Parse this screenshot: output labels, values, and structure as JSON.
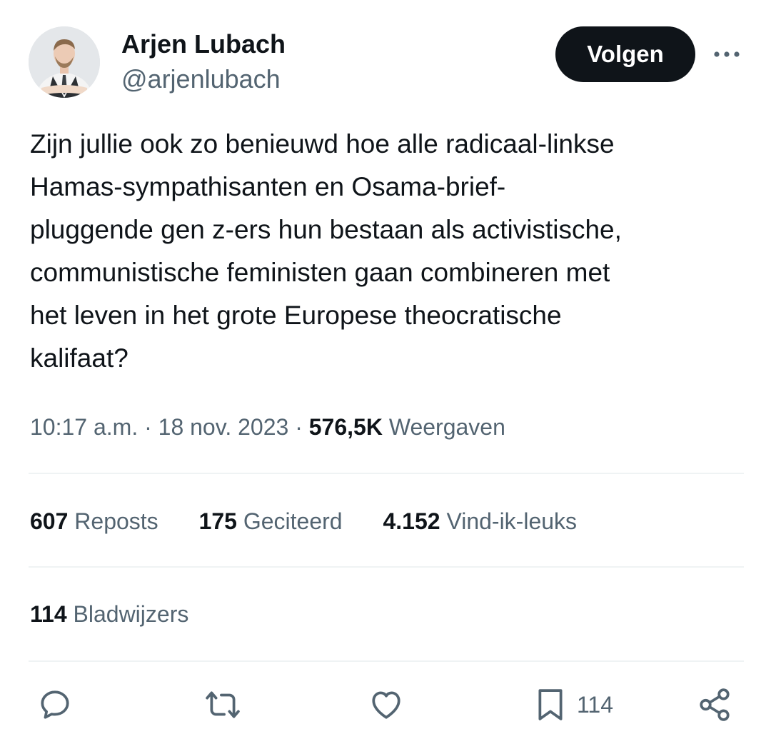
{
  "tweet": {
    "author": {
      "display_name": "Arjen Lubach",
      "handle": "@arjenlubach",
      "avatar_icon": "profile-photo"
    },
    "follow_label": "Volgen",
    "more_icon": "more-horizontal-icon",
    "text": "Zijn jullie ook zo benieuwd hoe alle radicaal-linkse\nHamas-sympathisanten en Osama-brief-\npluggende gen z-ers hun bestaan als activistische,\ncommunistische feministen gaan combineren met\nhet leven in het grote Europese theocratische\nkalifaat?",
    "meta": {
      "time": "10:17 a.m.",
      "separator": " · ",
      "date": "18 nov. 2023",
      "views_count": "576,5K",
      "views_label": "Weergaven"
    },
    "stats": {
      "reposts_count": "607",
      "reposts_label": "Reposts",
      "quotes_count": "175",
      "quotes_label": "Geciteerd",
      "likes_count": "4.152",
      "likes_label": "Vind-ik-leuks"
    },
    "bookmarks": {
      "count": "114",
      "label": "Bladwijzers"
    },
    "actions": {
      "reply_icon": "reply-icon",
      "repost_icon": "repost-icon",
      "like_icon": "heart-icon",
      "bookmark_icon": "bookmark-icon",
      "bookmark_count": "114",
      "share_icon": "share-icon"
    },
    "colors": {
      "text": "#0f1419",
      "secondary": "#536471",
      "divider": "#eff3f4",
      "button_bg": "#0f1419",
      "button_text": "#ffffff"
    }
  }
}
